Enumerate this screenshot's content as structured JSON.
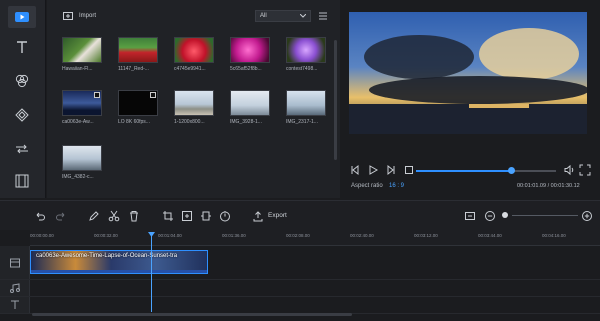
{
  "app": {
    "accent": "#2e8fff"
  },
  "rail": {
    "items": [
      {
        "name": "media",
        "icon": "play-icon"
      },
      {
        "name": "text",
        "icon": "text-icon"
      },
      {
        "name": "filters",
        "icon": "filters-icon"
      },
      {
        "name": "overlays",
        "icon": "overlay-icon"
      },
      {
        "name": "transitions",
        "icon": "transition-icon"
      },
      {
        "name": "elements",
        "icon": "film-icon"
      }
    ]
  },
  "media": {
    "import_label": "Import",
    "filter_value": "All",
    "items": [
      {
        "label": "Hawaiian-Fl...",
        "kind": "image"
      },
      {
        "label": "11147_Red-...",
        "kind": "image"
      },
      {
        "label": "c4745e9941...",
        "kind": "image"
      },
      {
        "label": "5c65af52f8b...",
        "kind": "image"
      },
      {
        "label": "contest7498...",
        "kind": "image"
      },
      {
        "label": "ca0063e-Aw...",
        "kind": "video"
      },
      {
        "label": "LO 8K 60fps...",
        "kind": "video"
      },
      {
        "label": "1-1200x800...",
        "kind": "image"
      },
      {
        "label": "IMG_3928-1...",
        "kind": "image"
      },
      {
        "label": "IMG_2317-1...",
        "kind": "image"
      },
      {
        "label": "IMG_4382-c...",
        "kind": "image"
      }
    ]
  },
  "preview": {
    "aspect_label": "Aspect ratio",
    "aspect_value": "16 : 9",
    "time_current": "00:01:01.09",
    "time_total": "00:01:30.12",
    "progress": 0.68
  },
  "toolbar": {
    "export_label": "Export",
    "tools": [
      "undo-icon",
      "redo-icon",
      "edit-icon",
      "split-icon",
      "delete-icon",
      "crop-icon",
      "freeze-icon",
      "fit-icon",
      "speed-icon",
      "export-icon",
      "zoom-fit-icon",
      "zoom-out-icon",
      "zoom-in-icon"
    ]
  },
  "timeline": {
    "ruler": [
      "00:00:00.00",
      "00:00:32.00",
      "00:01:04.00",
      "00:01:36.00",
      "00:02:08.00",
      "00:02:40.00",
      "00:03:12.00",
      "00:03:44.00",
      "00:04:16.00"
    ],
    "clip_title": "ca0063e-Awesome-Time-Lapse-of-Ocean-Sunset-tra",
    "playhead_time": "00:01:04.00"
  }
}
